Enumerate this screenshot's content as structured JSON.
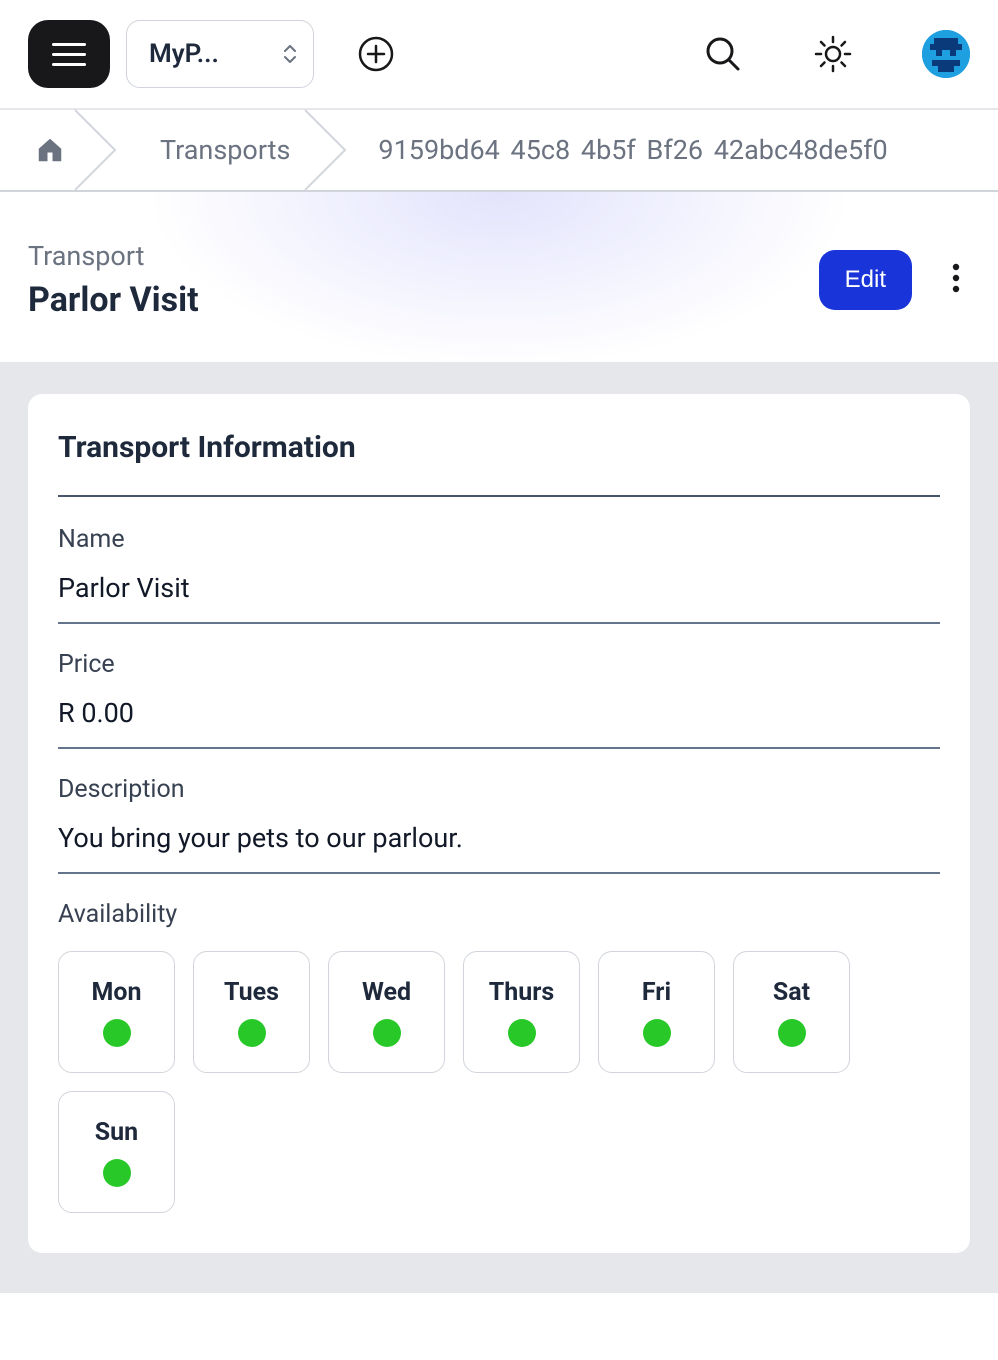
{
  "topbar": {
    "app_select_label": "MyP..."
  },
  "breadcrumb": {
    "seg1": "Transports",
    "id": "9159bd64 45c8 4b5f Bf26 42abc48de5f0"
  },
  "hero": {
    "subtitle": "Transport",
    "title": "Parlor Visit",
    "edit_label": "Edit"
  },
  "card": {
    "title": "Transport Information",
    "fields": {
      "name_label": "Name",
      "name_value": "Parlor Visit",
      "price_label": "Price",
      "price_value": "R 0.00",
      "desc_label": "Description",
      "desc_value": "You bring your pets to our parlour."
    },
    "availability_label": "Availability",
    "days": [
      {
        "label": "Mon",
        "available": true
      },
      {
        "label": "Tues",
        "available": true
      },
      {
        "label": "Wed",
        "available": true
      },
      {
        "label": "Thurs",
        "available": true
      },
      {
        "label": "Fri",
        "available": true
      },
      {
        "label": "Sat",
        "available": true
      },
      {
        "label": "Sun",
        "available": true
      }
    ]
  }
}
